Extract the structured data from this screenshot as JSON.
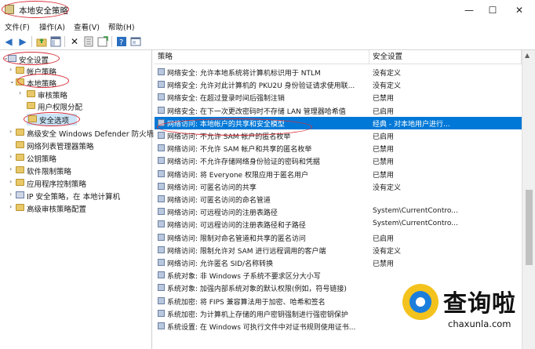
{
  "window": {
    "title": "本地安全策略",
    "minimize_glyph": "—",
    "maximize_glyph": "☐",
    "close_glyph": "✕"
  },
  "menu": [
    "文件(F)",
    "操作(A)",
    "查看(V)",
    "帮助(H)"
  ],
  "toolbar": {
    "icons": [
      "back-arrow-icon",
      "forward-arrow-icon",
      "up-folder-icon",
      "show-tree-icon",
      "delete-icon",
      "properties-icon",
      "export-list-icon",
      "help-icon",
      "console-view-icon"
    ]
  },
  "tree": [
    {
      "label": "安全设置",
      "icon": "shield",
      "expanded": true
    },
    {
      "label": "帐户策略",
      "icon": "folder",
      "expanded": false
    },
    {
      "label": "本地策略",
      "icon": "folder",
      "expanded": true
    },
    {
      "label": "审核策略",
      "icon": "folder",
      "expanded": false
    },
    {
      "label": "用户权限分配",
      "icon": "folder",
      "expanded": false
    },
    {
      "label": "安全选项",
      "icon": "folder",
      "selected": true
    },
    {
      "label": "高级安全 Windows Defender 防火墙",
      "icon": "folder",
      "expanded": false
    },
    {
      "label": "网络列表管理器策略",
      "icon": "folder"
    },
    {
      "label": "公钥策略",
      "icon": "folder",
      "expanded": false
    },
    {
      "label": "软件限制策略",
      "icon": "folder",
      "expanded": false
    },
    {
      "label": "应用程序控制策略",
      "icon": "folder",
      "expanded": false
    },
    {
      "label": "IP 安全策略，在 本地计算机",
      "icon": "shield",
      "expanded": false
    },
    {
      "label": "高级审核策略配置",
      "icon": "folder",
      "expanded": false
    }
  ],
  "list": {
    "headers": {
      "policy": "策略",
      "setting": "安全设置"
    },
    "rows": [
      {
        "policy": "网络安全: 允许本地系统将计算机标识用于 NTLM",
        "setting": "没有定义"
      },
      {
        "policy": "网络安全: 允许对此计算机的 PKU2U 身份验证请求使用联...",
        "setting": "没有定义"
      },
      {
        "policy": "网络安全: 在超过登录时间后强制注销",
        "setting": "已禁用"
      },
      {
        "policy": "网络安全: 在下一次更改密码时不存储 LAN 管理器哈希值",
        "setting": "已启用"
      },
      {
        "policy": "网络访问: 本地帐户的共享和安全模型",
        "setting": "经典 - 对本地用户进行...",
        "selected": true
      },
      {
        "policy": "网络访问: 不允许 SAM 帐户的匿名枚举",
        "setting": "已启用"
      },
      {
        "policy": "网络访问: 不允许 SAM 帐户和共享的匿名枚举",
        "setting": "已禁用"
      },
      {
        "policy": "网络访问: 不允许存储网络身份验证的密码和凭据",
        "setting": "已禁用"
      },
      {
        "policy": "网络访问: 将 Everyone 权限应用于匿名用户",
        "setting": "已禁用"
      },
      {
        "policy": "网络访问: 可匿名访问的共享",
        "setting": "没有定义"
      },
      {
        "policy": "网络访问: 可匿名访问的命名管道",
        "setting": ""
      },
      {
        "policy": "网络访问: 可远程访问的注册表路径",
        "setting": "System\\CurrentContro..."
      },
      {
        "policy": "网络访问: 可远程访问的注册表路径和子路径",
        "setting": "System\\CurrentContro..."
      },
      {
        "policy": "网络访问: 限制对命名管道和共享的匿名访问",
        "setting": "已启用"
      },
      {
        "policy": "网络访问: 限制允许对 SAM 进行远程调用的客户端",
        "setting": "没有定义"
      },
      {
        "policy": "网络访问: 允许匿名 SID/名称转换",
        "setting": "已禁用"
      },
      {
        "policy": "系统对象: 非 Windows 子系统不要求区分大小写",
        "setting": ""
      },
      {
        "policy": "系统对象: 加强内部系统对象的默认权限(例如，符号链接)",
        "setting": ""
      },
      {
        "policy": "系统加密: 将 FIPS 兼容算法用于加密、哈希和签名",
        "setting": ""
      },
      {
        "policy": "系统加密: 为计算机上存储的用户密钥强制进行强密钥保护",
        "setting": ""
      },
      {
        "policy": "系统设置: 在 Windows 可执行文件中对证书规则使用证书...",
        "setting": ""
      }
    ]
  },
  "watermark": {
    "text_cn": "查询啦",
    "text_en": "chaxunla.com"
  },
  "colors": {
    "selection": "#0078d7",
    "annotation": "#d9303a",
    "tree_selection": "#cce4f7"
  }
}
